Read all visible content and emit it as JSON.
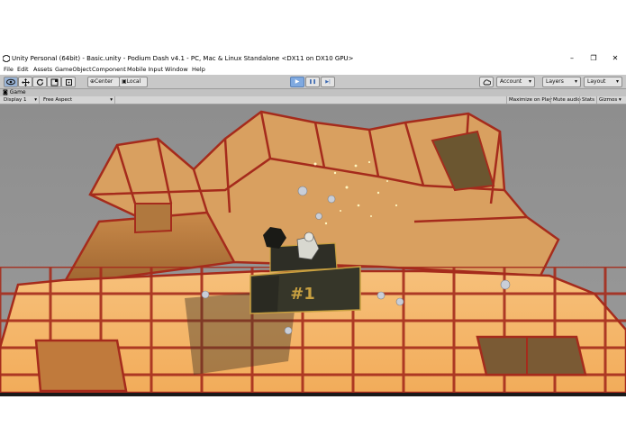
{
  "window": {
    "title": "Unity Personal (64bit) - Basic.unity - Podium Dash v4.1 - PC, Mac & Linux Standalone <DX11 on DX10 GPU>",
    "controls": [
      "–",
      "❐",
      "✕"
    ]
  },
  "menu": [
    "File",
    "Edit",
    "Assets",
    "GameObject",
    "Component",
    "Mobile Input",
    "Window",
    "Help"
  ],
  "toolbar": {
    "tools": [
      "hand-icon",
      "move-icon",
      "rotate-icon",
      "scale-icon",
      "rect-icon"
    ],
    "pivot_label": "Center",
    "space_label": "Local",
    "play_icons": [
      "▶",
      "❚❚",
      "▶|"
    ],
    "cloud_icon": "cloud-icon",
    "account_label": "Account",
    "layers_label": "Layers",
    "layout_label": "Layout"
  },
  "game_view": {
    "tab_label": "Game",
    "display_label": "Display 1",
    "aspect_label": "Free Aspect",
    "buttons": [
      "Maximize on Play",
      "Mute audio",
      "Stats",
      "Gizmos"
    ],
    "podium_label": "#1"
  },
  "colors": {
    "tile_face": "#f0b060",
    "tile_edge": "#a02818",
    "podium": "#3a3a30",
    "podium_trim": "#c8a040",
    "play_accent": "#7fa9e0"
  }
}
